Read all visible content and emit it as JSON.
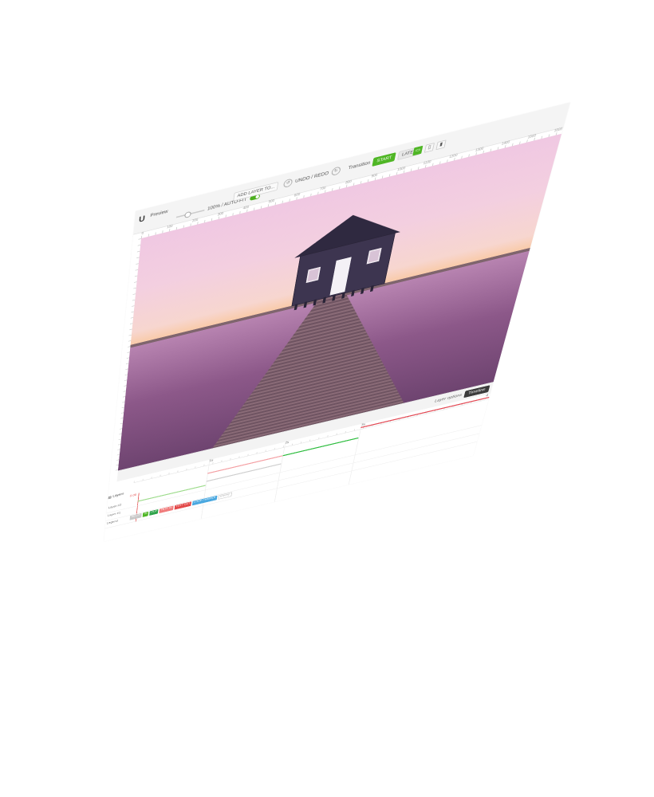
{
  "app": {
    "logo": "U",
    "preview_label": "Preview",
    "zoom_label": "100% / AUTO-FIT",
    "add_layer_label": "ADD LAYER TO...",
    "undo_redo_label": "UNDO / REDO",
    "transition_label": "Transition",
    "start_label": "START",
    "later_label": "LATER"
  },
  "hruler_numbers": [
    "0",
    "100",
    "200",
    "300",
    "400",
    "500",
    "600",
    "700",
    "800",
    "900",
    "1000",
    "1100",
    "1200",
    "1300",
    "1400",
    "1500",
    "1600"
  ],
  "options_bar": {
    "layer_options_label": "Layer options",
    "timeline_label": "Timeline"
  },
  "timeline": {
    "layers_label": "Layers",
    "seconds": [
      "1s",
      "2s",
      "3s",
      "4"
    ],
    "current_time": "0.00",
    "rows": [
      {
        "name": "Layer #2"
      },
      {
        "name": "Layer #1"
      },
      {
        "name": "Legend"
      }
    ],
    "tags": [
      {
        "label": "DELAY",
        "color": "#c8c8c8"
      },
      {
        "label": "IN",
        "color": "#4fb625"
      },
      {
        "label": "OUT",
        "color": "#2ea34a"
      },
      {
        "label": "TEXT IN",
        "color": "#f07c7c"
      },
      {
        "label": "TEXT OUT",
        "color": "#e24a4a"
      },
      {
        "label": "LOOP / MIDDLE",
        "color": "#4aa8e0"
      },
      {
        "label": "STATIC",
        "color": "#ffffff"
      }
    ],
    "colors": {
      "green": "#2ebd3f",
      "light_green": "#9fdc8e",
      "red": "#e24a55",
      "light_red": "#f4a0a4",
      "grey": "#cfcfcf"
    }
  }
}
